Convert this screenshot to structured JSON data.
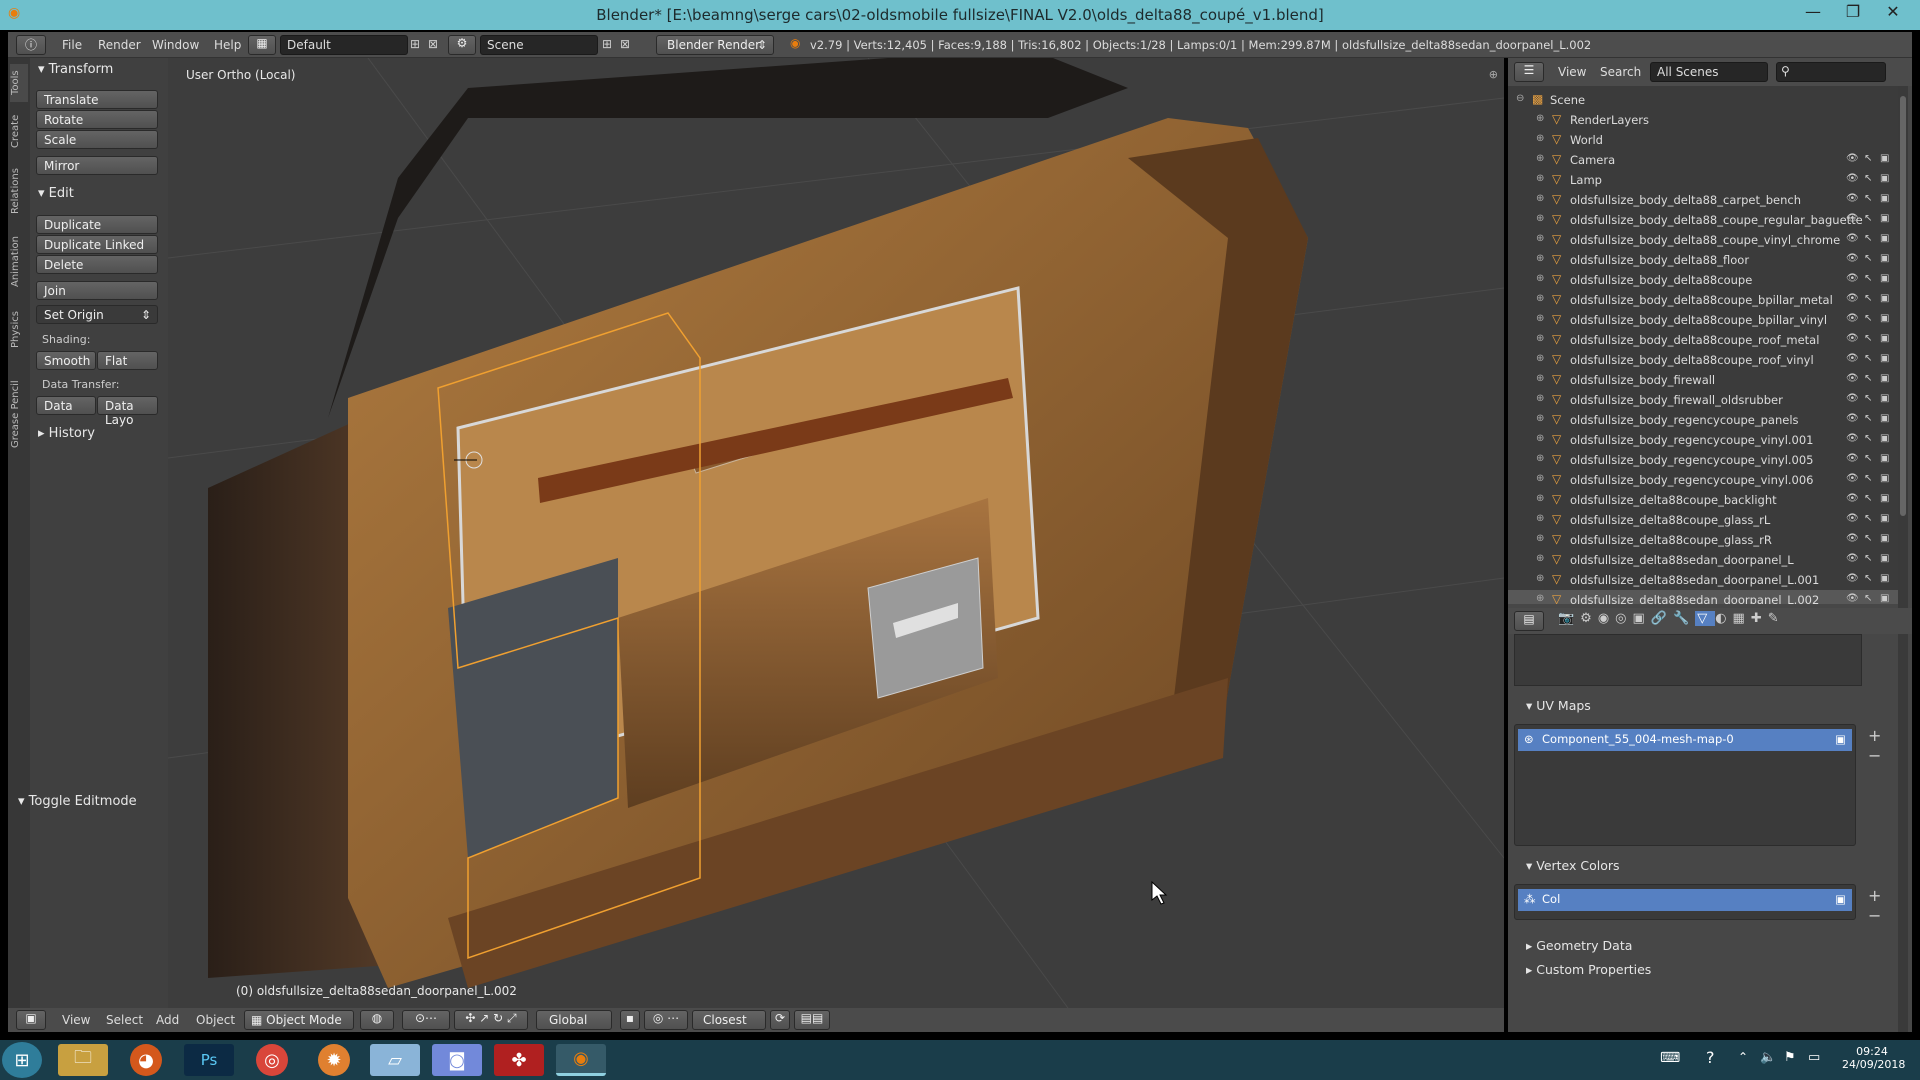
{
  "window": {
    "title": "Blender* [E:\\beamng\\serge cars\\02-oldsmobile fullsize\\FINAL V2.0\\olds_delta88_coupé_v1.blend]",
    "minimize": "—",
    "maximize": "❐",
    "close": "✕"
  },
  "menubar": {
    "menus": [
      "File",
      "Render",
      "Window",
      "Help"
    ],
    "screen_layout": "Default",
    "scene": "Scene",
    "render_engine": "Blender Render",
    "stats": "v2.79 | Verts:12,405 | Faces:9,188 | Tris:16,802 | Objects:1/28 | Lamps:0/1 | Mem:299.87M | oldsfullsize_delta88sedan_doorpanel_L.002"
  },
  "toolshelf": {
    "tabs": [
      "Tools",
      "Create",
      "Relations",
      "Animation",
      "Physics",
      "Grease Pencil"
    ],
    "transform_header": "Transform",
    "transform_buttons": [
      "Translate",
      "Rotate",
      "Scale"
    ],
    "mirror": "Mirror",
    "edit_header": "Edit",
    "edit_buttons": [
      "Duplicate",
      "Duplicate Linked",
      "Delete"
    ],
    "join": "Join",
    "set_origin": "Set Origin",
    "shading_label": "Shading:",
    "smooth": "Smooth",
    "flat": "Flat",
    "data_transfer_label": "Data Transfer:",
    "data": "Data",
    "data_layout": "Data Layo",
    "history_header": "History",
    "operator_header": "Toggle Editmode"
  },
  "viewport": {
    "view_name": "User Ortho (Local)",
    "object_label": "(0) oldsfullsize_delta88sedan_doorpanel_L.002"
  },
  "viewport_header": {
    "menus": [
      "View",
      "Select",
      "Add",
      "Object"
    ],
    "mode": "Object Mode",
    "orientation": "Global",
    "snap": "Closest"
  },
  "outliner": {
    "menus": [
      "View",
      "Search"
    ],
    "scene_filter": "All Scenes",
    "rows": [
      {
        "name": "Scene",
        "indent": 0
      },
      {
        "name": "RenderLayers",
        "indent": 1
      },
      {
        "name": "World",
        "indent": 1
      },
      {
        "name": "Camera",
        "indent": 1
      },
      {
        "name": "Lamp",
        "indent": 1
      },
      {
        "name": "oldsfullsize_body_delta88_carpet_bench",
        "indent": 1
      },
      {
        "name": "oldsfullsize_body_delta88_coupe_regular_baguette",
        "indent": 1
      },
      {
        "name": "oldsfullsize_body_delta88_coupe_vinyl_chrome",
        "indent": 1
      },
      {
        "name": "oldsfullsize_body_delta88_floor",
        "indent": 1
      },
      {
        "name": "oldsfullsize_body_delta88coupe",
        "indent": 1
      },
      {
        "name": "oldsfullsize_body_delta88coupe_bpillar_metal",
        "indent": 1
      },
      {
        "name": "oldsfullsize_body_delta88coupe_bpillar_vinyl",
        "indent": 1
      },
      {
        "name": "oldsfullsize_body_delta88coupe_roof_metal",
        "indent": 1
      },
      {
        "name": "oldsfullsize_body_delta88coupe_roof_vinyl",
        "indent": 1
      },
      {
        "name": "oldsfullsize_body_firewall",
        "indent": 1
      },
      {
        "name": "oldsfullsize_body_firewall_oldsrubber",
        "indent": 1
      },
      {
        "name": "oldsfullsize_body_regencycoupe_panels",
        "indent": 1
      },
      {
        "name": "oldsfullsize_body_regencycoupe_vinyl.001",
        "indent": 1
      },
      {
        "name": "oldsfullsize_body_regencycoupe_vinyl.005",
        "indent": 1
      },
      {
        "name": "oldsfullsize_body_regencycoupe_vinyl.006",
        "indent": 1
      },
      {
        "name": "oldsfullsize_delta88coupe_backlight",
        "indent": 1
      },
      {
        "name": "oldsfullsize_delta88coupe_glass_rL",
        "indent": 1
      },
      {
        "name": "oldsfullsize_delta88coupe_glass_rR",
        "indent": 1
      },
      {
        "name": "oldsfullsize_delta88sedan_doorpanel_L",
        "indent": 1
      },
      {
        "name": "oldsfullsize_delta88sedan_doorpanel_L.001",
        "indent": 1
      },
      {
        "name": "oldsfullsize_delta88sedan_doorpanel_L.002",
        "indent": 1
      }
    ]
  },
  "properties": {
    "uv_maps_header": "UV Maps",
    "uv_map_item": "Component_55_004-mesh-map-0",
    "vertex_colors_header": "Vertex Colors",
    "vertex_color_item": "Col",
    "geometry_data_header": "Geometry Data",
    "custom_properties_header": "Custom Properties"
  },
  "taskbar": {
    "time": "09:24",
    "date": "24/09/2018",
    "apps": [
      "start",
      "file-explorer",
      "firefox",
      "photoshop",
      "chrome",
      "blender-alt",
      "notepad",
      "discord",
      "ida",
      "blender"
    ]
  },
  "colors": {
    "accent_select": "#5680c2",
    "titlebar": "#6fc0cc",
    "outline_orange": "#f0a030"
  }
}
